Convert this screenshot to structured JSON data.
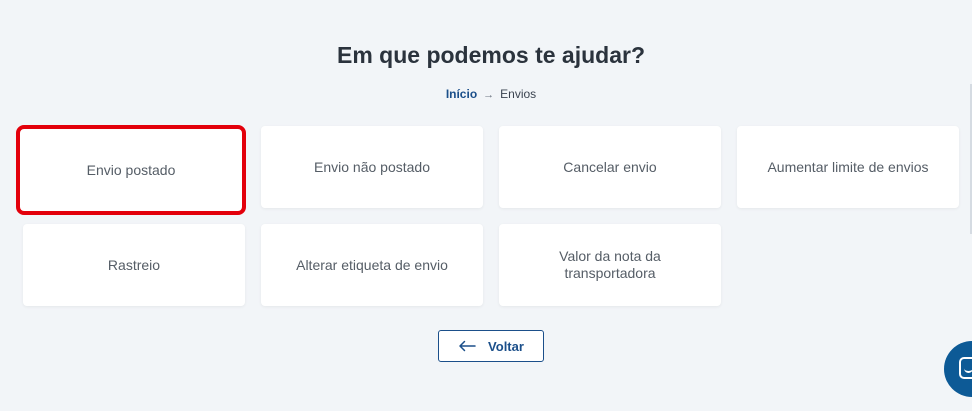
{
  "header": {
    "title": "Em que podemos te ajudar?"
  },
  "breadcrumb": {
    "home": "Início",
    "separator": "→",
    "current": "Envios"
  },
  "options": [
    {
      "label": "Envio postado",
      "selected": true
    },
    {
      "label": "Envio não postado",
      "selected": false
    },
    {
      "label": "Cancelar envio",
      "selected": false
    },
    {
      "label": "Aumentar limite de envios",
      "selected": false
    },
    {
      "label": "Rastreio",
      "selected": false
    },
    {
      "label": "Alterar etiqueta de envio",
      "selected": false
    },
    {
      "label": "Valor da nota da transportadora",
      "selected": false
    }
  ],
  "back_button": {
    "label": "Voltar",
    "icon": "arrow-left-icon"
  },
  "chat": {
    "icon": "chat-icon"
  },
  "colors": {
    "background": "#f2f5f8",
    "accent": "#1b4f8a",
    "highlight": "#e3000b",
    "chat": "#0d5a96"
  }
}
